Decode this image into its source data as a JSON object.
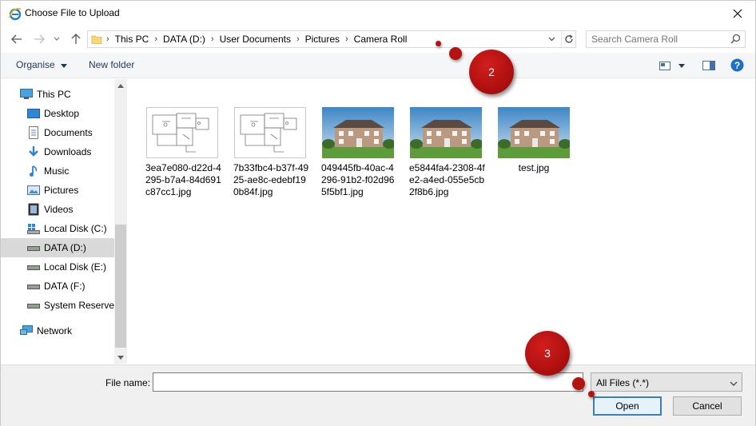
{
  "window": {
    "title": "Choose File to Upload",
    "icon": "internet-explorer-icon"
  },
  "address": {
    "crumbs": [
      "This PC",
      "DATA (D:)",
      "User Documents",
      "Pictures",
      "Camera Roll"
    ],
    "search_placeholder": "Search Camera Roll"
  },
  "toolbar": {
    "organise_label": "Organise",
    "new_folder_label": "New folder"
  },
  "sidebar": {
    "items": [
      {
        "label": "This PC",
        "icon": "computer-icon"
      },
      {
        "label": "Desktop",
        "icon": "desktop-icon"
      },
      {
        "label": "Documents",
        "icon": "documents-icon"
      },
      {
        "label": "Downloads",
        "icon": "downloads-icon"
      },
      {
        "label": "Music",
        "icon": "music-icon"
      },
      {
        "label": "Pictures",
        "icon": "pictures-icon"
      },
      {
        "label": "Videos",
        "icon": "videos-icon"
      },
      {
        "label": "Local Disk (C:)",
        "icon": "windows-drive-icon"
      },
      {
        "label": "DATA (D:)",
        "icon": "drive-icon",
        "selected": true
      },
      {
        "label": "Local Disk (E:)",
        "icon": "drive-icon"
      },
      {
        "label": "DATA (F:)",
        "icon": "drive-icon"
      },
      {
        "label": "System Reserved",
        "icon": "drive-icon"
      },
      {
        "label": "Network",
        "icon": "network-icon"
      }
    ]
  },
  "files": [
    {
      "name": "3ea7e080-d22d-4295-b7a4-84d691c87cc1.jpg",
      "thumb": "floorplan"
    },
    {
      "name": "7b33fbc4-b37f-4925-ae8c-edebf190b84f.jpg",
      "thumb": "floorplan"
    },
    {
      "name": "049445fb-40ac-4296-91b2-f02d965f5bf1.jpg",
      "thumb": "house"
    },
    {
      "name": "e5844fa4-2308-4fe2-a4ed-055e5cb2f8b6.jpg",
      "thumb": "house"
    },
    {
      "name": "test.jpg",
      "thumb": "house"
    }
  ],
  "bottom": {
    "file_name_label": "File name:",
    "file_name_value": "",
    "filter_value": "All Files (*.*)",
    "open_label": "Open",
    "cancel_label": "Cancel"
  },
  "annotations": {
    "step2": "2",
    "step3": "3"
  },
  "colors": {
    "accent": "#3c7fb1",
    "marker": "#b51212",
    "link_text": "#1e395b",
    "selected_bg": "#d9d9d9"
  }
}
